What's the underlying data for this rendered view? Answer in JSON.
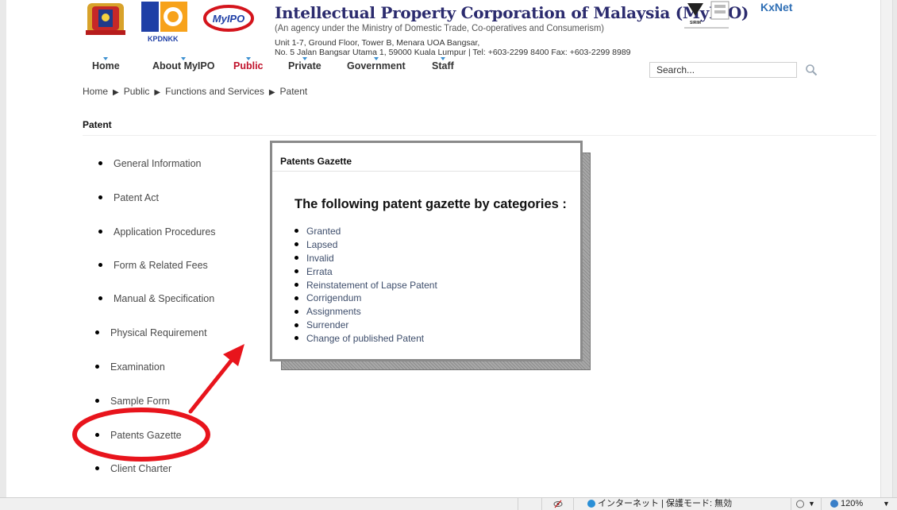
{
  "header": {
    "title": "Intellectual Property Corporation of Malaysia (MyIPO)",
    "subtitle": "(An agency under the Ministry of Domestic Trade, Co-operatives and Consumerism)",
    "address_line1": "Unit 1-7, Ground Floor, Tower B, Menara UOA Bangsar,",
    "address_line2": "No. 5 Jalan Bangsar Utama 1, 59000 Kuala Lumpur | Tel: +603-2299 8400 Fax: +603-2299 8989",
    "logos": {
      "kpdnkk_text": "KPDNKK",
      "mypo_text": "MyIPO",
      "sirim_text": "SIRIM",
      "knet_text": "KxNet"
    }
  },
  "nav": {
    "items": [
      {
        "label": "Home"
      },
      {
        "label": "About MyIPO"
      },
      {
        "label": "Public",
        "active": true
      },
      {
        "label": "Private"
      },
      {
        "label": "Government"
      },
      {
        "label": "Staff"
      }
    ]
  },
  "search": {
    "value": "Search..."
  },
  "breadcrumb": [
    "Home",
    "Public",
    "Functions and Services",
    "Patent"
  ],
  "section_title": "Patent",
  "side_menu": {
    "items": [
      "General Information",
      "Patent Act",
      "Application Procedures",
      "Form & Related Fees",
      "Manual & Specification",
      "Physical Requirement",
      "Examination",
      "Sample Form",
      "Patents Gazette",
      "Client Charter"
    ],
    "highlighted": "Patents Gazette"
  },
  "popup": {
    "title": "Patents Gazette",
    "heading": "The following patent gazette by categories :",
    "items": [
      "Granted",
      "Lapsed",
      "Invalid",
      "Errata",
      "Reinstatement of Lapse Patent",
      "Corrigendum",
      "Assignments",
      "Surrender",
      "Change of published Patent"
    ]
  },
  "annotation": {
    "color": "#e8141c"
  },
  "status_bar": {
    "zone_text": "インターネット | 保護モード: 無効",
    "zoom": "120%"
  },
  "colors": {
    "accent": "#c0122b",
    "link": "#3d4d6b",
    "title": "#2b2b6e"
  }
}
